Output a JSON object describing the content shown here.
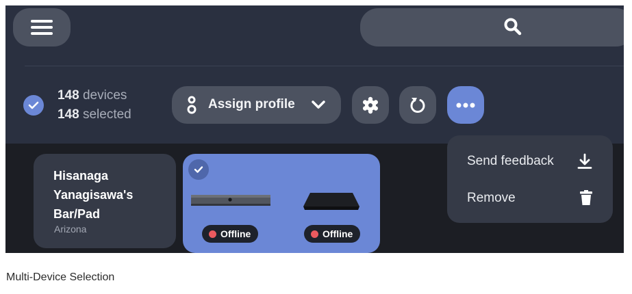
{
  "header": {
    "menu_icon": "hamburger-menu-icon",
    "search_icon": "search-icon"
  },
  "selection": {
    "device_count": "148",
    "device_label": "devices",
    "selected_count": "148",
    "selected_label": "selected"
  },
  "toolbar": {
    "assign_label": "Assign profile",
    "assign_icon": "profile-icon",
    "settings_icon": "gear-icon",
    "restart_icon": "restart-icon",
    "more_icon": "more-horizontal-icon"
  },
  "cards": [
    {
      "name": "Hisanaga Yanagisawa's Bar/Pad",
      "location": "Arizona"
    },
    {
      "status_1": "Offline",
      "status_2": "Offline"
    }
  ],
  "dropdown": {
    "items": [
      {
        "label": "Send feedback",
        "icon": "download-icon"
      },
      {
        "label": "Remove",
        "icon": "trash-icon"
      }
    ]
  },
  "caption": "Multi-Device Selection",
  "colors": {
    "accent": "#6b87d6",
    "header_bg": "#2a3040",
    "button_bg": "#4c5260",
    "offline": "#ec5a5f"
  }
}
